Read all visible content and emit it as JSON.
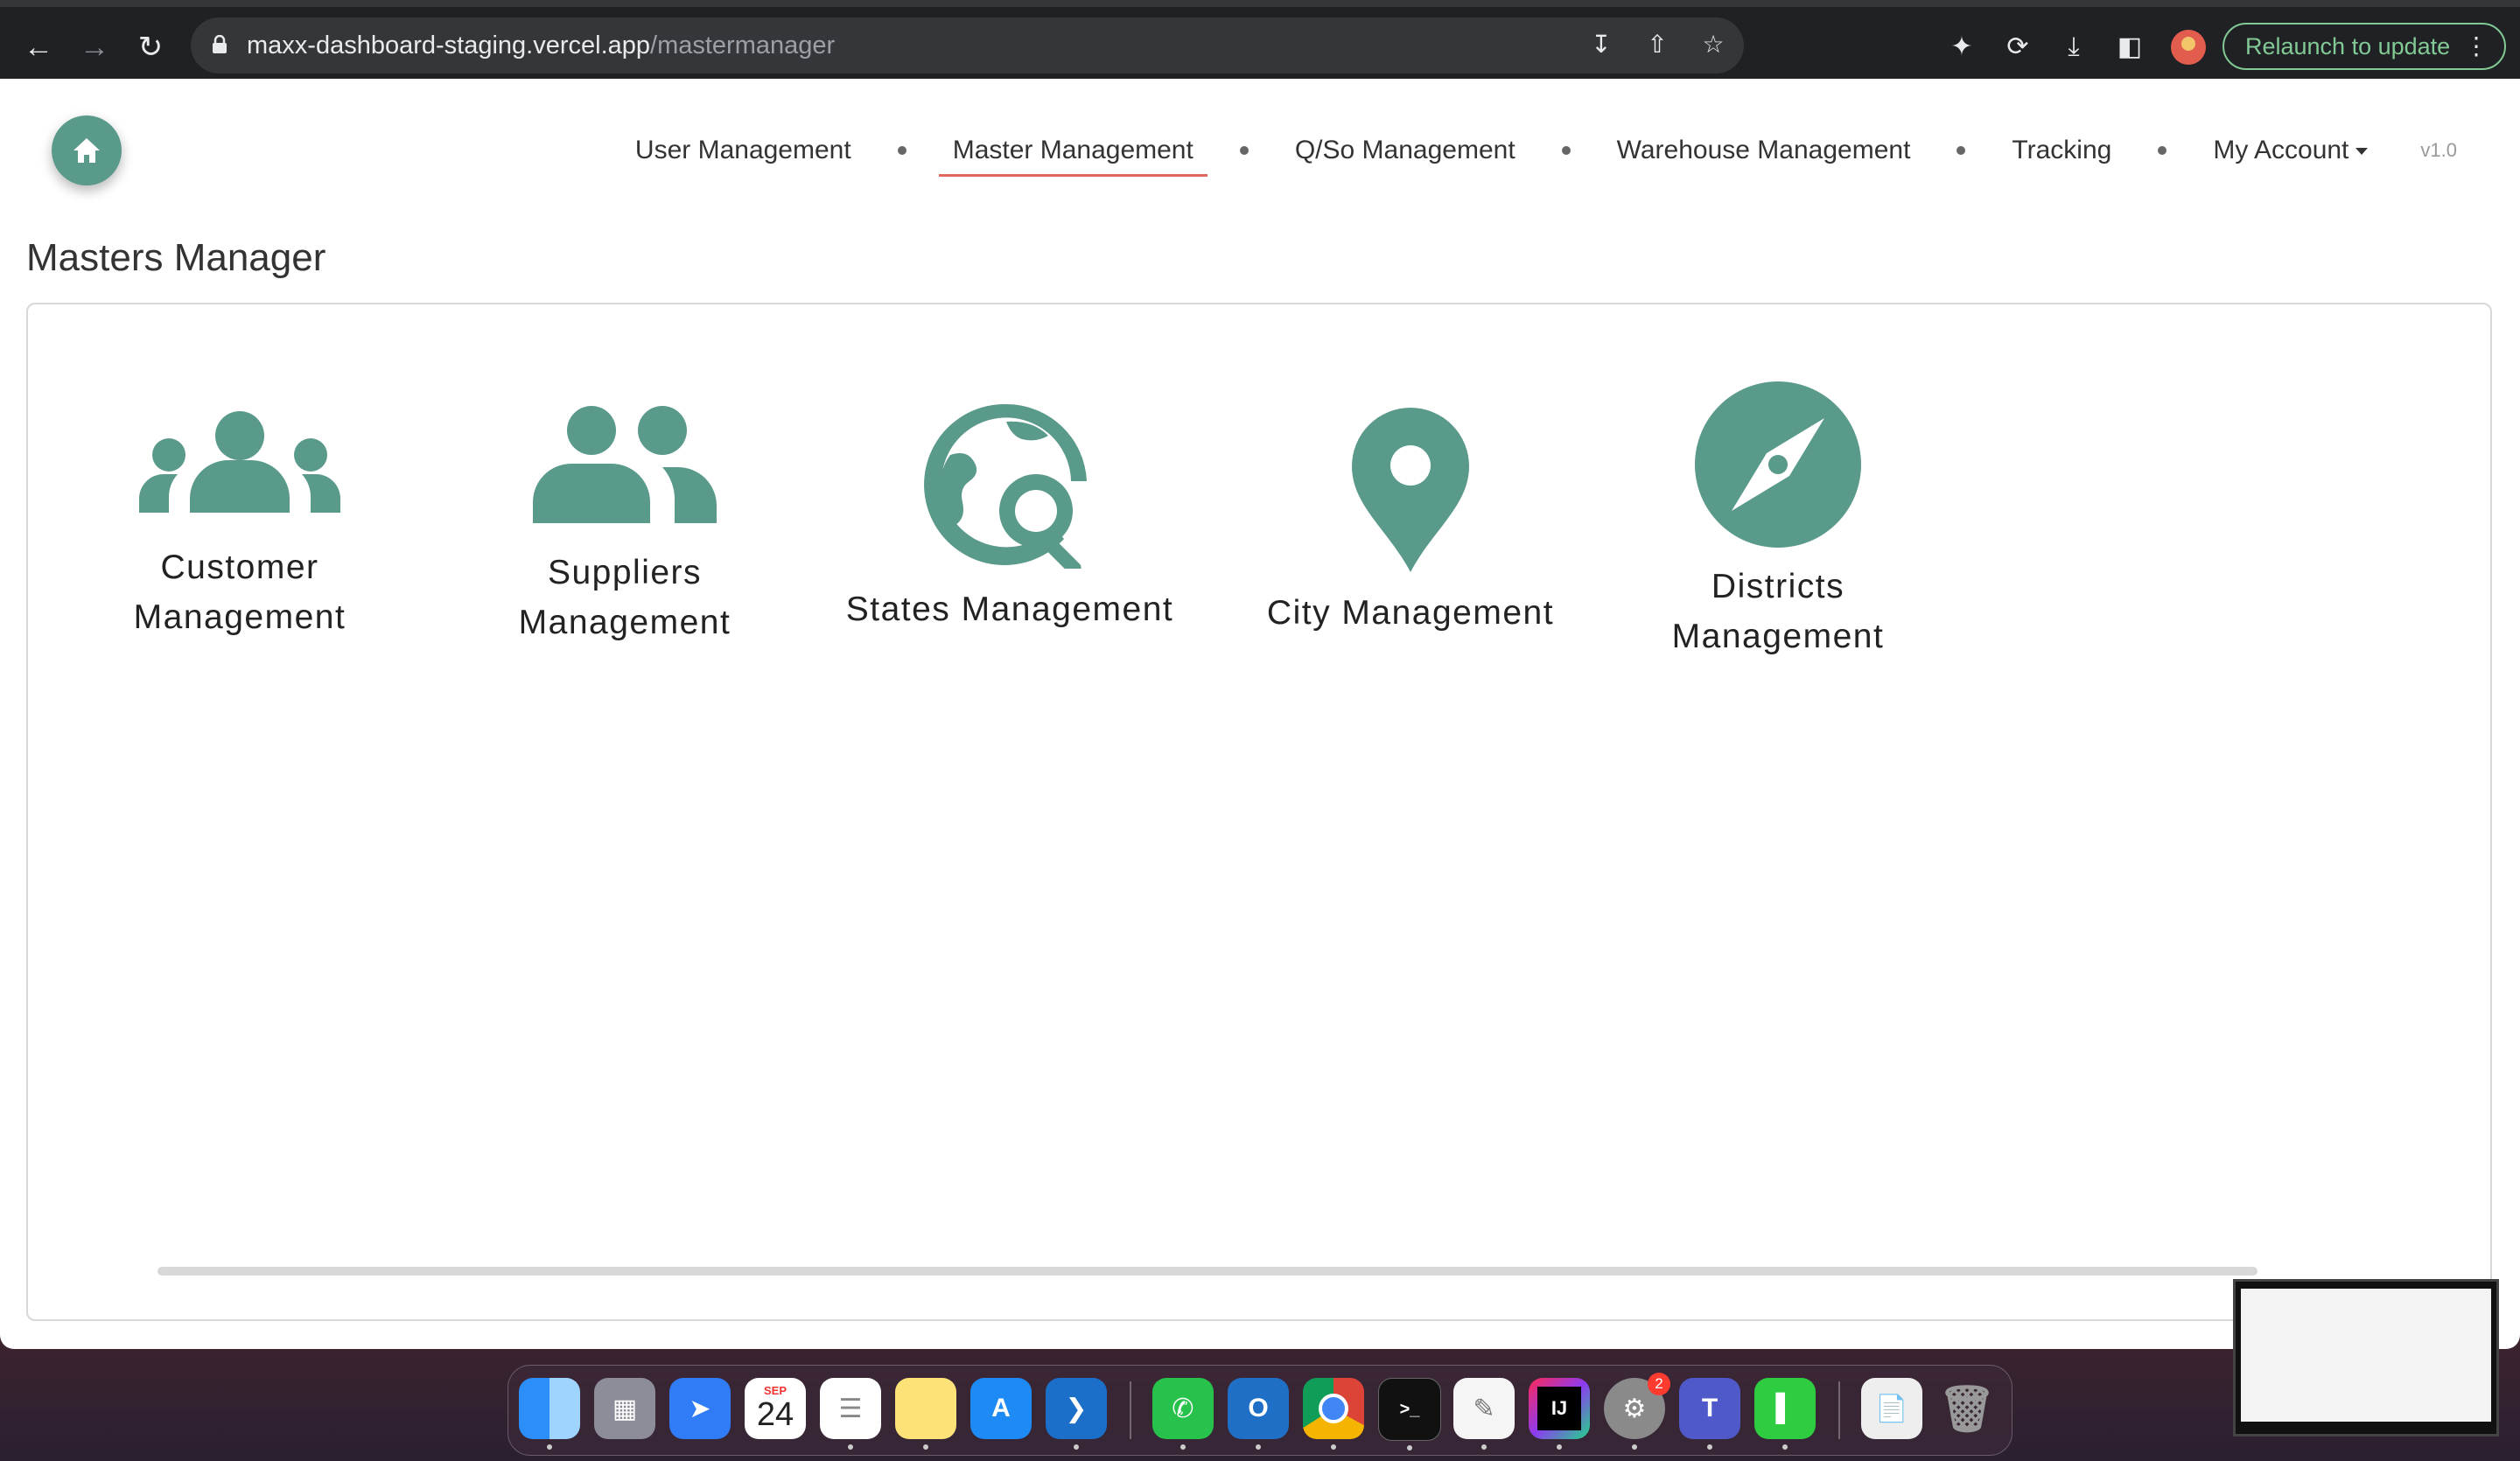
{
  "browser": {
    "url_host": "maxx-dashboard-staging.vercel.app",
    "url_path": "/mastermanager",
    "relaunch_label": "Relaunch to update"
  },
  "nav": {
    "items": [
      {
        "label": "User Management",
        "active": false
      },
      {
        "label": "Master Management",
        "active": true
      },
      {
        "label": "Q/So Management",
        "active": false
      },
      {
        "label": "Warehouse Management",
        "active": false
      },
      {
        "label": "Tracking",
        "active": false
      },
      {
        "label": "My Account",
        "active": false
      }
    ],
    "version": "v1.0"
  },
  "page": {
    "title": "Masters Manager"
  },
  "tiles": [
    {
      "line1": "Customer",
      "line2": "Management",
      "icon": "users-group-icon"
    },
    {
      "line1": "Suppliers",
      "line2": "Management",
      "icon": "user-friends-icon"
    },
    {
      "line1": "States Management",
      "line2": "",
      "icon": "globe-search-icon"
    },
    {
      "line1": "City Management",
      "line2": "",
      "icon": "map-pin-icon"
    },
    {
      "line1": "Districts",
      "line2": "Management",
      "icon": "compass-icon"
    }
  ],
  "dock": {
    "calendar_month": "SEP",
    "calendar_day": "24",
    "settings_badge": "2"
  },
  "colors": {
    "accent": "#5a9a8b",
    "active_underline": "#e0675d"
  }
}
